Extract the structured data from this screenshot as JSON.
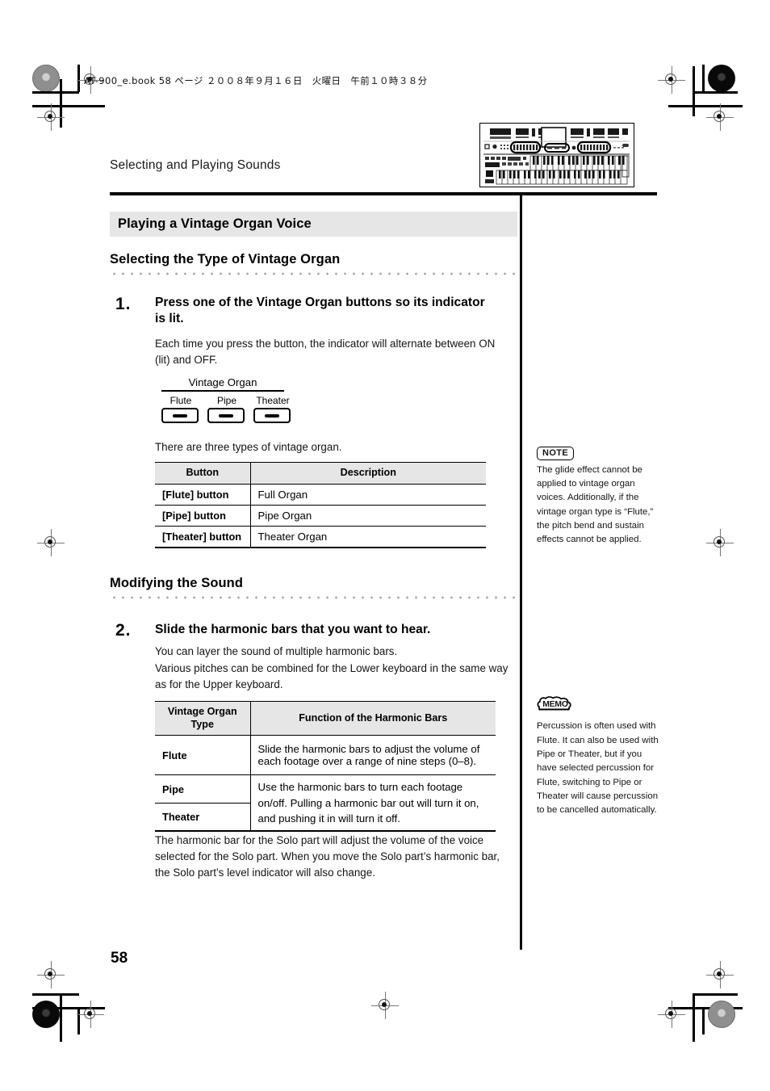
{
  "page": {
    "file_header": "AT-900_e.book  58 ページ  ２００８年９月１６日　火曜日　午前１０時３８分",
    "running_head": "Selecting and Playing Sounds",
    "page_number": "58",
    "device_illustration_name": "roland-atelier-organ-illustration"
  },
  "section": {
    "title": "Playing a Vintage Organ Voice"
  },
  "subsections": [
    {
      "title": "Selecting the Type of Vintage Organ"
    },
    {
      "title": "Modifying the Sound"
    }
  ],
  "steps": [
    {
      "number": "1.",
      "title": "Press one of the Vintage Organ buttons so its indicator is lit.",
      "body": "Each time you press the button, the indicator will alternate between ON (lit) and OFF.",
      "after_figure_text": "There are three types of vintage organ."
    },
    {
      "number": "2.",
      "title": "Slide the harmonic bars that you want to hear.",
      "body_line1": "You can layer the sound of multiple harmonic bars.",
      "body_line2": "Various pitches can be combined for the Lower keyboard in the same way as for the Upper keyboard.",
      "closing": "The harmonic bar for the Solo part will adjust the volume of the voice selected for the Solo part. When you move the Solo part’s harmonic bar, the Solo part’s level indicator will also change."
    }
  ],
  "vintage_organ_figure": {
    "group_label": "Vintage Organ",
    "buttons": [
      {
        "label": "Flute"
      },
      {
        "label": "Pipe"
      },
      {
        "label": "Theater"
      }
    ]
  },
  "table_buttons": {
    "headers": [
      "Button",
      "Description"
    ],
    "rows": [
      {
        "button": "[Flute] button",
        "description": "Full Organ"
      },
      {
        "button": "[Pipe] button",
        "description": "Pipe Organ"
      },
      {
        "button": "[Theater] button",
        "description": "Theater Organ"
      }
    ]
  },
  "table_harmonic": {
    "headers": [
      "Vintage Organ\nType",
      "Function of the Harmonic Bars"
    ],
    "header_col1_line1": "Vintage Organ",
    "header_col1_line2": "Type",
    "header_col2": "Function of the Harmonic Bars",
    "rows": [
      {
        "type": "Flute",
        "function": "Slide the harmonic bars to adjust the volume of each footage over a range of nine steps (0–8)."
      },
      {
        "type": "Pipe",
        "function": "Use the harmonic bars to turn each footage on/off. Pulling a harmonic bar out will turn it on, and pushing it in will turn it off."
      },
      {
        "type": "Theater",
        "function": ""
      }
    ]
  },
  "side_notes": [
    {
      "badge": "NOTE",
      "badge_icon": "note-badge-icon",
      "text": "The glide effect cannot be applied to vintage organ voices. Additionally, if the vintage organ type is “Flute,” the pitch bend and sustain effects cannot be applied."
    },
    {
      "badge": "MEMO",
      "badge_icon": "memo-badge-icon",
      "text": "Percussion is often used with Flute. It can also be used with Pipe or Theater, but if you have selected percussion for Flute, switching to Pipe or Theater will cause percussion to be cancelled automatically."
    }
  ],
  "colors": {
    "section_bar_bg": "#e6e6e6",
    "table_header_bg": "#e6e6e6",
    "rule": "#000000",
    "dot_rule": "#a8a8a8",
    "body_text": "#141414"
  }
}
